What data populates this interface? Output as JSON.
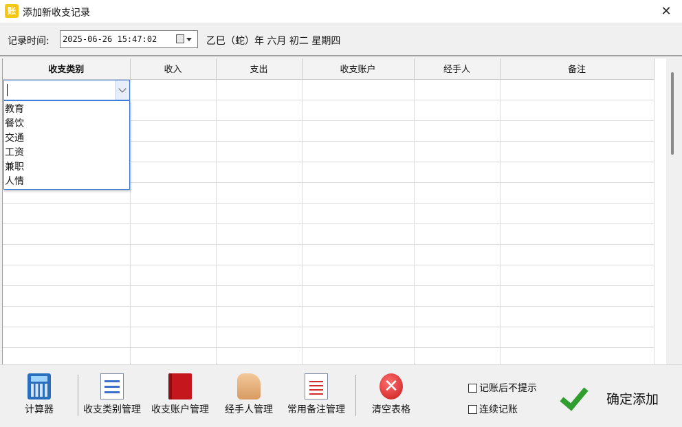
{
  "window": {
    "title": "添加新收支记录",
    "app_icon_glyph": "账",
    "close_glyph": "✕"
  },
  "timebar": {
    "label": "记录时间:",
    "datetime": "2025-06-26 15:47:02",
    "lunar": "乙巳（蛇）年 六月 初二 星期四"
  },
  "grid": {
    "columns": [
      "收支类别",
      "收入",
      "支出",
      "收支账户",
      "经手人",
      "备注"
    ],
    "row_count": 14
  },
  "category_combo": {
    "value": "",
    "options": [
      "教育",
      "餐饮",
      "交通",
      "工资",
      "兼职",
      "人情"
    ]
  },
  "toolbar": {
    "calculator": "计算器",
    "category_mgmt": "收支类别管理",
    "account_mgmt": "收支账户管理",
    "handler_mgmt": "经手人管理",
    "memo_mgmt": "常用备注管理",
    "clear_table": "清空表格",
    "no_prompt": "记账后不提示",
    "continuous": "连续记账",
    "confirm": "确定添加"
  },
  "colors": {
    "accent": "#3c7fd9",
    "confirm_green": "#2f9e2f",
    "clear_red": "#c81a1a"
  }
}
